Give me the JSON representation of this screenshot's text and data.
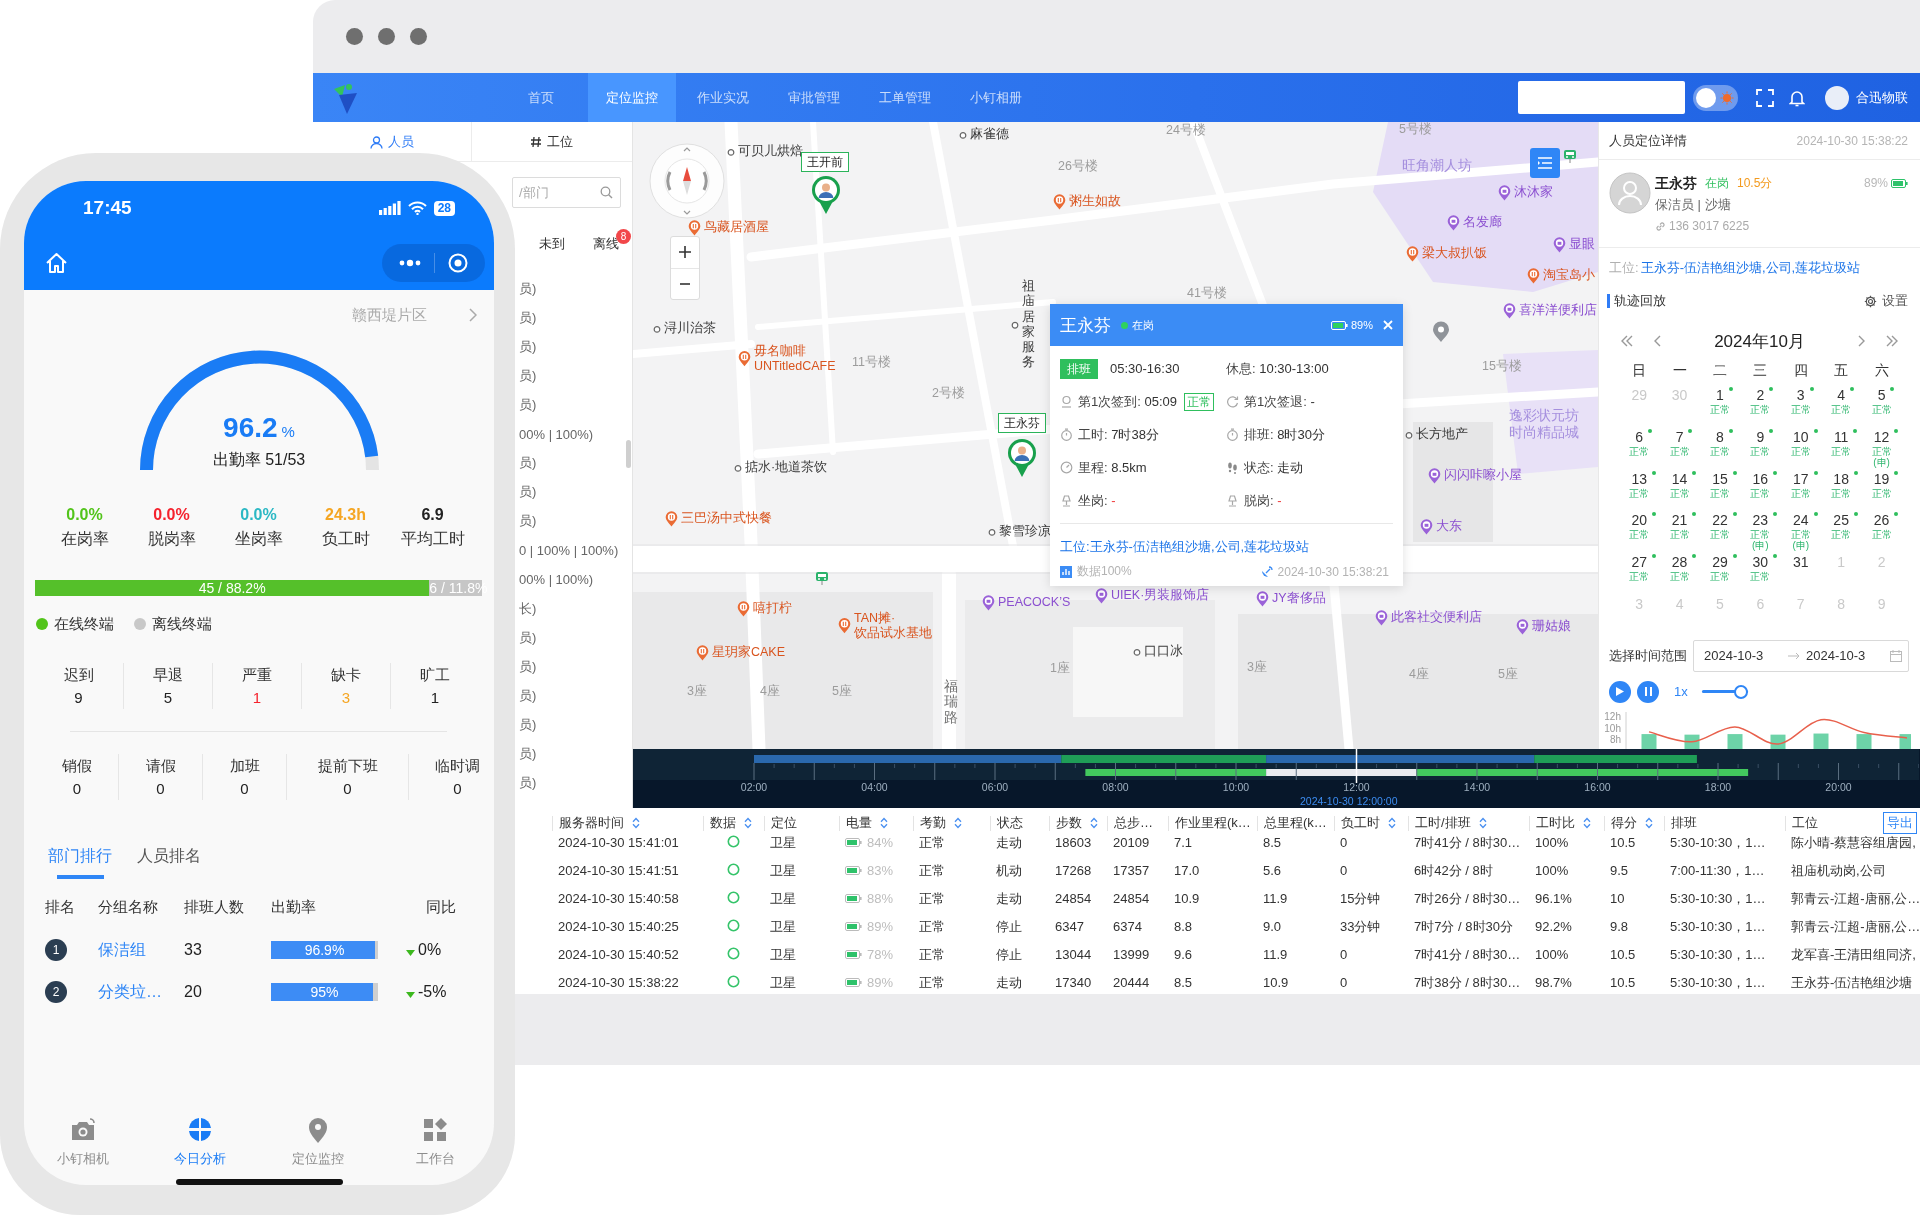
{
  "phone": {
    "status_bar": {
      "time": "17:45",
      "battery": "28"
    },
    "region": "赣西堤片区",
    "gauge": {
      "value": "96.2",
      "unit": "%",
      "caption": "出勤率 51/53",
      "level": 0.962
    },
    "rates": [
      {
        "value": "0.0%",
        "label": "在岗率",
        "color": "#52c41a"
      },
      {
        "value": "0.0%",
        "label": "脱岗率",
        "color": "#f5222d"
      },
      {
        "value": "0.0%",
        "label": "坐岗率",
        "color": "#2bb8c4"
      },
      {
        "value": "24.3h",
        "label": "负工时",
        "color": "#f5a623"
      },
      {
        "value": "6.9",
        "label": "平均工时",
        "color": "#222222"
      }
    ],
    "terminals": {
      "level": 0.882,
      "online": "45 / 88.2%",
      "offline": "6 / 11.8%"
    },
    "legend": [
      {
        "label": "在线终端",
        "color": "#52c41a"
      },
      {
        "label": "离线终端",
        "color": "#c8c8c8"
      }
    ],
    "exceptions": [
      {
        "label": "迟到",
        "value": "9",
        "color": "#222222"
      },
      {
        "label": "早退",
        "value": "5",
        "color": "#222222"
      },
      {
        "label": "严重",
        "value": "1",
        "color": "#f5222d"
      },
      {
        "label": "缺卡",
        "value": "3",
        "color": "#f5a623"
      },
      {
        "label": "旷工",
        "value": "1",
        "color": "#222222"
      }
    ],
    "requests": [
      {
        "label": "销假",
        "value": "0"
      },
      {
        "label": "请假",
        "value": "0"
      },
      {
        "label": "加班",
        "value": "0"
      },
      {
        "label": "提前下班",
        "value": "0"
      },
      {
        "label": "临时调",
        "value": "0"
      }
    ],
    "tabs": [
      {
        "label": "部门排行",
        "selected": true
      },
      {
        "label": "人员排名",
        "selected": false
      }
    ],
    "ranking": {
      "columns": [
        "排名",
        "分组名称",
        "排班人数",
        "出勤率",
        "同比"
      ],
      "rows": [
        {
          "rank": "1",
          "group": "保洁组",
          "staff": "33",
          "rate": "96.9%",
          "level": 0.969,
          "decrease": true,
          "change": "0%"
        },
        {
          "rank": "2",
          "group": "分类垃…",
          "staff": "20",
          "rate": "95%",
          "level": 0.95,
          "decrease": true,
          "change": "-5%"
        }
      ]
    },
    "tabbar": [
      {
        "label": "小钉相机",
        "selected": false
      },
      {
        "label": "今日分析",
        "selected": true
      },
      {
        "label": "定位监控",
        "selected": false
      },
      {
        "label": "工作台",
        "selected": false
      }
    ]
  },
  "desktop": {
    "nav": {
      "items": [
        {
          "label": "首页",
          "selected": false
        },
        {
          "label": "定位监控",
          "selected": true
        },
        {
          "label": "作业实况",
          "selected": false
        },
        {
          "label": "审批管理",
          "selected": false
        },
        {
          "label": "工单管理",
          "selected": false
        },
        {
          "label": "小钉相册",
          "selected": false
        }
      ],
      "theme_toggle": {
        "on": false
      },
      "user": "合迅物联"
    },
    "sidebar": {
      "tabs": [
        {
          "label": "人员",
          "selected": true
        },
        {
          "label": "工位",
          "selected": false
        }
      ],
      "search": {
        "placeholder": "/部门"
      },
      "filters": [
        {
          "label": "未到"
        },
        {
          "label": "离线",
          "badge": "8"
        }
      ],
      "rows": [
        "员)",
        "员)",
        "员)",
        "员)",
        "员)",
        "00% | 100%)",
        "员)",
        "员)",
        "员)",
        "0 | 100% | 100%)",
        "00% | 100%)",
        "长)",
        "员)",
        "员)",
        "员)",
        "员)",
        "员)",
        "员)"
      ]
    },
    "map": {
      "labels": [
        {
          "kind": "dot",
          "text": "麻雀德"
        },
        {
          "kind": "building",
          "text": "24号楼"
        },
        {
          "kind": "building",
          "text": "5号楼"
        },
        {
          "kind": "dot",
          "text": "可贝儿烘焙"
        },
        {
          "kind": "building",
          "text": "26号楼"
        },
        {
          "kind": "area",
          "text": "旺角潮人坊"
        },
        {
          "kind": "food",
          "text": "粥生如故"
        },
        {
          "kind": "shop",
          "text": "沐沐家"
        },
        {
          "kind": "food",
          "text": "鸟藏居酒屋"
        },
        {
          "kind": "shop",
          "text": "名发廊"
        },
        {
          "kind": "food",
          "text": "梁大叔扒饭"
        },
        {
          "kind": "shop",
          "text": "显眼"
        },
        {
          "kind": "food",
          "text": "淘宝岛小"
        },
        {
          "kind": "building",
          "text": "41号楼"
        },
        {
          "kind": "dot",
          "text": "浔川治茶"
        },
        {
          "kind": "food",
          "text": "毋名咖啡\nUNTitledCAFE"
        },
        {
          "kind": "dot",
          "text": "祖庙居家服务"
        },
        {
          "kind": "shop",
          "text": "喜洋洋便利店"
        },
        {
          "kind": "building",
          "text": "11号楼"
        },
        {
          "kind": "building",
          "text": "15号楼"
        },
        {
          "kind": "building",
          "text": "2号楼"
        },
        {
          "kind": "dot",
          "text": "长方地产"
        },
        {
          "kind": "area",
          "text": "逸彩状元坊时尚精品城"
        },
        {
          "kind": "dot",
          "text": "掂水·地道茶饮"
        },
        {
          "kind": "shop",
          "text": "闪闪咔嚓小屋"
        },
        {
          "kind": "food",
          "text": "三巴汤中式快餐"
        },
        {
          "kind": "dot",
          "text": "黎雪珍凉"
        },
        {
          "kind": "shop",
          "text": "大东"
        },
        {
          "kind": "food",
          "text": "嘻打柠"
        },
        {
          "kind": "shop",
          "text": "PEACOCK’S"
        },
        {
          "kind": "shop",
          "text": "UIEK·男装服饰店"
        },
        {
          "kind": "shop",
          "text": "JY奢侈品"
        },
        {
          "kind": "food",
          "text": "TAN摊·\n饮品试水基地"
        },
        {
          "kind": "shop",
          "text": "此客社交便利店"
        },
        {
          "kind": "shop",
          "text": "珊姑娘"
        },
        {
          "kind": "food",
          "text": "星玥家CAKE"
        },
        {
          "kind": "dot",
          "text": "口口冰"
        },
        {
          "kind": "building",
          "text": "1座"
        },
        {
          "kind": "building",
          "text": "3座"
        },
        {
          "kind": "building",
          "text": "4座"
        },
        {
          "kind": "building",
          "text": "5座"
        },
        {
          "kind": "building",
          "text": "3座"
        },
        {
          "kind": "building",
          "text": "4座"
        },
        {
          "kind": "building",
          "text": "5座"
        },
        {
          "kind": "road",
          "text": "福瑞路"
        }
      ],
      "markers": [
        {
          "name": "王开前"
        },
        {
          "name": "王永芬"
        }
      ],
      "popup": {
        "name": "王永芬",
        "status": "在岗",
        "battery": "89%",
        "fields": [
          {
            "kind": "shift",
            "caption": "排班",
            "value": "05:30-16:30",
            "alert": false
          },
          {
            "kind": "rest",
            "caption": "休息:",
            "value": "10:30-13:00",
            "alert": false
          },
          {
            "kind": "checkin",
            "caption": "第1次签到:",
            "value": "05:09",
            "tag": "正常",
            "alert": false
          },
          {
            "kind": "checkout",
            "caption": "第1次签退:",
            "value": "-",
            "alert": false
          },
          {
            "kind": "timer",
            "caption": "工时:",
            "value": "7时38分",
            "alert": false
          },
          {
            "kind": "timer",
            "caption": "排班:",
            "value": "8时30分",
            "alert": false
          },
          {
            "kind": "distance",
            "caption": "里程:",
            "value": "8.5km",
            "alert": false
          },
          {
            "kind": "motion",
            "caption": "状态:",
            "value": "走动",
            "alert": false
          },
          {
            "kind": "post",
            "caption": "坐岗:",
            "value": "-",
            "alert": true
          },
          {
            "kind": "post",
            "caption": "脱岗:",
            "value": "-",
            "alert": true
          }
        ],
        "station": "工位:王永芬-伍洁艳组沙塘,公司,莲花垃圾站",
        "data": "数据100%",
        "time": "2024-10-30 15:38:21"
      }
    },
    "detail": {
      "title": "人员定位详情",
      "time": "2024-10-30 15:38:22",
      "person": {
        "name": "王永芬",
        "status": "在岗",
        "score": "10.5分",
        "battery": "89%",
        "role": "保洁员 | 沙塘",
        "phone": "136 3017 6225"
      },
      "station_label": "工位:",
      "station": "王永芬-伍洁艳组沙塘,公司,莲花垃圾站",
      "track_title": "轨迹回放",
      "settings": "设置",
      "calendar": {
        "month": "2024年10月",
        "weekdays": [
          "日",
          "一",
          "二",
          "三",
          "四",
          "五",
          "六"
        ],
        "days": [
          {
            "day": "29",
            "muted": true,
            "dot": false
          },
          {
            "day": "30",
            "muted": true,
            "dot": false
          },
          {
            "day": "1",
            "muted": false,
            "dot": true,
            "note": "正常"
          },
          {
            "day": "2",
            "muted": false,
            "dot": true,
            "note": "正常"
          },
          {
            "day": "3",
            "muted": false,
            "dot": true,
            "note": "正常"
          },
          {
            "day": "4",
            "muted": false,
            "dot": true,
            "note": "正常"
          },
          {
            "day": "5",
            "muted": false,
            "dot": true,
            "note": "正常"
          },
          {
            "day": "6",
            "muted": false,
            "dot": true,
            "note": "正常"
          },
          {
            "day": "7",
            "muted": false,
            "dot": true,
            "note": "正常"
          },
          {
            "day": "8",
            "muted": false,
            "dot": true,
            "note": "正常"
          },
          {
            "day": "9",
            "muted": false,
            "dot": true,
            "note": "正常"
          },
          {
            "day": "10",
            "muted": false,
            "dot": true,
            "note": "正常"
          },
          {
            "day": "11",
            "muted": false,
            "dot": true,
            "note": "正常"
          },
          {
            "day": "12",
            "muted": false,
            "dot": true,
            "note": "正常(申)"
          },
          {
            "day": "13",
            "muted": false,
            "dot": true,
            "note": "正常"
          },
          {
            "day": "14",
            "muted": false,
            "dot": true,
            "note": "正常"
          },
          {
            "day": "15",
            "muted": false,
            "dot": true,
            "note": "正常"
          },
          {
            "day": "16",
            "muted": false,
            "dot": true,
            "note": "正常"
          },
          {
            "day": "17",
            "muted": false,
            "dot": true,
            "note": "正常"
          },
          {
            "day": "18",
            "muted": false,
            "dot": true,
            "note": "正常"
          },
          {
            "day": "19",
            "muted": false,
            "dot": true,
            "note": "正常"
          },
          {
            "day": "20",
            "muted": false,
            "dot": true,
            "note": "正常"
          },
          {
            "day": "21",
            "muted": false,
            "dot": true,
            "note": "正常"
          },
          {
            "day": "22",
            "muted": false,
            "dot": true,
            "note": "正常"
          },
          {
            "day": "23",
            "muted": false,
            "dot": true,
            "note": "正常(申)"
          },
          {
            "day": "24",
            "muted": false,
            "dot": true,
            "note": "正常(申)"
          },
          {
            "day": "25",
            "muted": false,
            "dot": true,
            "note": "正常"
          },
          {
            "day": "26",
            "muted": false,
            "dot": true,
            "note": "正常"
          },
          {
            "day": "27",
            "muted": false,
            "dot": true,
            "note": "正常"
          },
          {
            "day": "28",
            "muted": false,
            "dot": true,
            "note": "正常"
          },
          {
            "day": "29",
            "muted": false,
            "dot": true,
            "note": "正常"
          },
          {
            "day": "30",
            "muted": false,
            "dot": true,
            "note": "正常"
          },
          {
            "day": "31",
            "muted": false,
            "dot": false
          },
          {
            "day": "1",
            "muted": true,
            "dot": false
          },
          {
            "day": "2",
            "muted": true,
            "dot": false
          },
          {
            "day": "3",
            "muted": true,
            "dot": false
          },
          {
            "day": "4",
            "muted": true,
            "dot": false
          },
          {
            "day": "5",
            "muted": true,
            "dot": false
          },
          {
            "day": "6",
            "muted": true,
            "dot": false
          },
          {
            "day": "7",
            "muted": true,
            "dot": false
          },
          {
            "day": "8",
            "muted": true,
            "dot": false
          },
          {
            "day": "9",
            "muted": true,
            "dot": false
          }
        ]
      },
      "range": {
        "label": "选择时间范围",
        "start": "2024-10-3",
        "end": "2024-10-3"
      },
      "speed": "1x",
      "speed_slider": {
        "level": 1
      },
      "hours_chart": {
        "chart_data": {
          "type": "bar",
          "yticks": [
            {
              "value": 12,
              "label": "12h"
            },
            {
              "value": 10,
              "label": "10h"
            },
            {
              "value": 8,
              "label": "8h"
            }
          ],
          "ylim": [
            6.2,
            12.9
          ],
          "series": [
            {
              "color": "#6dd3a8",
              "values": [
                8.9,
                8.8,
                8.9,
                8.8,
                9,
                8.9,
                8.9
              ]
            }
          ]
        }
      },
      "trend_chart": {
        "chart_data": {
          "type": "line",
          "ylim": [
            6.2,
            12.9
          ],
          "series": [
            {
              "color": "#e8604c",
              "values": [
                9.3,
                7.5,
                10.2,
                7.1,
                11.5,
                9.2,
                8.2
              ]
            }
          ]
        }
      }
    },
    "timeline": {
      "ticks": [
        "02:00",
        "04:00",
        "06:00",
        "08:00",
        "10:00",
        "12:00",
        "14:00",
        "16:00",
        "18:00",
        "20:00"
      ],
      "cursor": "2024-10-30 12:00:00"
    },
    "table": {
      "columns": [
        {
          "label": "服务器时间",
          "sortable": true
        },
        {
          "label": "数据",
          "sortable": true
        },
        {
          "label": "定位",
          "sortable": false
        },
        {
          "label": "电量",
          "sortable": true
        },
        {
          "label": "考勤",
          "sortable": true
        },
        {
          "label": "状态",
          "sortable": false
        },
        {
          "label": "步数",
          "sortable": true
        },
        {
          "label": "总步…",
          "sortable": false
        },
        {
          "label": "作业里程(k…",
          "sortable": false
        },
        {
          "label": "总里程(k…",
          "sortable": false
        },
        {
          "label": "负工时",
          "sortable": true
        },
        {
          "label": "工时/排班",
          "sortable": true
        },
        {
          "label": "工时比",
          "sortable": true
        },
        {
          "label": "得分",
          "sortable": true
        },
        {
          "label": "排班",
          "sortable": false
        },
        {
          "label": "工位",
          "sortable": false
        }
      ],
      "export": "导出",
      "rows": [
        {
          "time": "2024-10-30 15:41:01",
          "online": true,
          "location": "卫星",
          "battery": "84%",
          "attendance": "正常",
          "status": "走动",
          "steps": "18603",
          "total_steps": "20109",
          "work_km": "7.1",
          "total_km": "8.5",
          "deficit": "0",
          "hours": "7时41分 / 8时30…",
          "ratio": "100%",
          "score": "10.5",
          "schedule": "5:30-10:30，1…",
          "station": "陈小晴-蔡慧容组唐园,"
        },
        {
          "time": "2024-10-30 15:41:51",
          "online": true,
          "location": "卫星",
          "battery": "83%",
          "attendance": "正常",
          "status": "机动",
          "steps": "17268",
          "total_steps": "17357",
          "work_km": "17.0",
          "total_km": "5.6",
          "deficit": "0",
          "hours": "6时42分 / 8时",
          "ratio": "100%",
          "score": "9.5",
          "schedule": "7:00-11:30，1…",
          "station": "祖庙机动岗,公司"
        },
        {
          "time": "2024-10-30 15:40:58",
          "online": true,
          "location": "卫星",
          "battery": "88%",
          "attendance": "正常",
          "status": "走动",
          "steps": "24854",
          "total_steps": "24854",
          "work_km": "10.9",
          "total_km": "11.9",
          "deficit": "15分钟",
          "hours": "7时26分 / 8时30…",
          "ratio": "96.1%",
          "score": "10",
          "schedule": "5:30-10:30，1…",
          "station": "郭青云-江超-唐丽,公…"
        },
        {
          "time": "2024-10-30 15:40:25",
          "online": true,
          "location": "卫星",
          "battery": "89%",
          "attendance": "正常",
          "status": "停止",
          "steps": "6347",
          "total_steps": "6374",
          "work_km": "8.8",
          "total_km": "9.0",
          "deficit": "33分钟",
          "hours": "7时7分 / 8时30分",
          "ratio": "92.2%",
          "score": "9.8",
          "schedule": "5:30-10:30，1…",
          "station": "郭青云-江超-唐丽,公…"
        },
        {
          "time": "2024-10-30 15:40:52",
          "online": true,
          "location": "卫星",
          "battery": "78%",
          "attendance": "正常",
          "status": "停止",
          "steps": "13044",
          "total_steps": "13999",
          "work_km": "9.6",
          "total_km": "11.9",
          "deficit": "0",
          "hours": "7时41分 / 8时30…",
          "ratio": "100%",
          "score": "10.5",
          "schedule": "5:30-10:30，1…",
          "station": "龙军喜-王清田组同济,"
        },
        {
          "time": "2024-10-30 15:38:22",
          "online": true,
          "location": "卫星",
          "battery": "89%",
          "attendance": "正常",
          "status": "走动",
          "steps": "17340",
          "total_steps": "20444",
          "work_km": "8.5",
          "total_km": "10.9",
          "deficit": "0",
          "hours": "7时38分 / 8时30…",
          "ratio": "98.7%",
          "score": "10.5",
          "schedule": "5:30-10:30，1…",
          "station": "王永芬-伍洁艳组沙塘"
        }
      ]
    }
  }
}
